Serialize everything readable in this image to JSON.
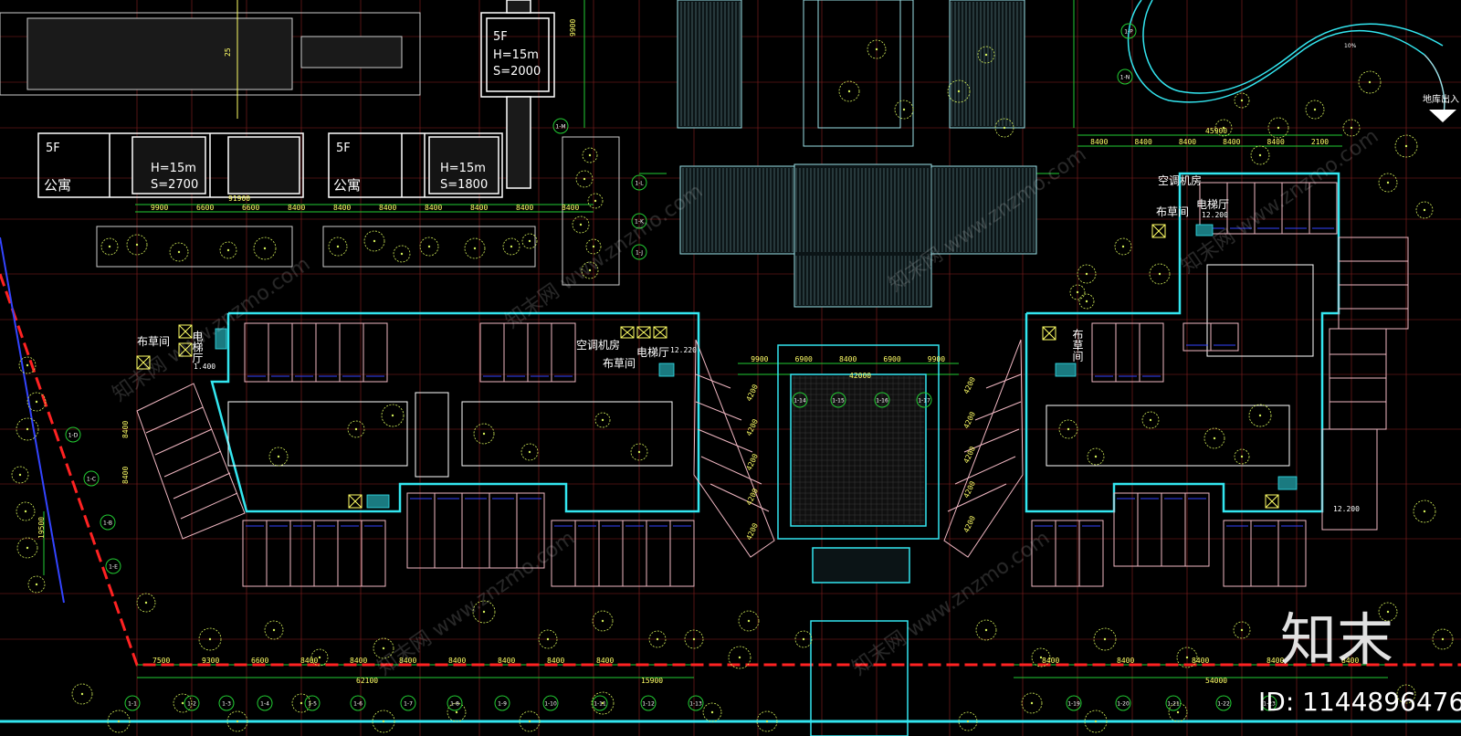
{
  "colors": {
    "background": "#000000",
    "wall": "#ffffff",
    "outline": "#33e6f0",
    "grid": "#ff3b3b",
    "dimension": "#ffff66",
    "tree": "#d4f05a",
    "green_line": "#22cc33",
    "blue_line": "#3344ff"
  },
  "buildings": [
    {
      "floors": "5F",
      "height": "H=15m",
      "area": "S=2000"
    },
    {
      "floors": "5F",
      "use": "公寓",
      "height": "H=15m",
      "area": "S=2700"
    },
    {
      "floors": "5F",
      "use": "公寓",
      "height": "H=15m",
      "area": "S=1800"
    }
  ],
  "rooms": {
    "linen_room": "布草间",
    "elevator_hall_vertical": "电梯厅",
    "elevator_hall": "电梯厅",
    "ac_room": "空调机房",
    "linen_room_vertical": "布草间"
  },
  "elevations": {
    "left_small": "1.400",
    "center_right": "12.220",
    "right_upper": "12.200",
    "right_lower": "12.200"
  },
  "garage_entrance": "地库出入",
  "slope_label": "10%",
  "brand_watermark": "知末",
  "id_label": "ID: 1144896476",
  "dimensions": {
    "top_left": [
      "9900",
      "6600",
      "6600",
      "8400",
      "8400",
      "8400",
      "8400",
      "8400",
      "8400",
      "8400"
    ],
    "top_left_total": "91900",
    "top_right": [
      "8400",
      "8400",
      "8400",
      "8400",
      "8400",
      "2100"
    ],
    "top_right_total": "45900",
    "plaza": [
      "9900",
      "6900",
      "8400",
      "6900",
      "9900"
    ],
    "plaza_total": "42000",
    "bottom_left": [
      "7500",
      "9300",
      "6600",
      "8400",
      "8400",
      "8400",
      "8400",
      "8400",
      "8400",
      "8400"
    ],
    "bottom_left_total": "62100",
    "bottom_mid_total": "15900",
    "bottom_right": [
      "8400",
      "8400",
      "8400",
      "8400",
      "8400"
    ],
    "bottom_right_total": "54000",
    "vertical_left": [
      "25",
      "9900",
      "19500",
      "8400",
      "8400"
    ],
    "vertical_right": [
      "4200",
      "4200",
      "4200",
      "4200",
      "4200"
    ]
  },
  "axis_labels": {
    "bottom": [
      "1-1",
      "1-2",
      "1-3",
      "1-4",
      "1-5",
      "1-6",
      "1-7",
      "1-8",
      "1-9",
      "1-10",
      "1-11",
      "1-12",
      "1-13",
      "1-19",
      "1-20",
      "1-21",
      "1-22",
      "1-23"
    ],
    "top_right": [
      "1-P",
      "1-N",
      "1-M",
      "1-L",
      "1-K",
      "1-J"
    ],
    "plaza": [
      "1-14",
      "1-15",
      "1-16",
      "1-17"
    ],
    "left": [
      "1-B",
      "1-C",
      "1-D",
      "1-E"
    ]
  }
}
